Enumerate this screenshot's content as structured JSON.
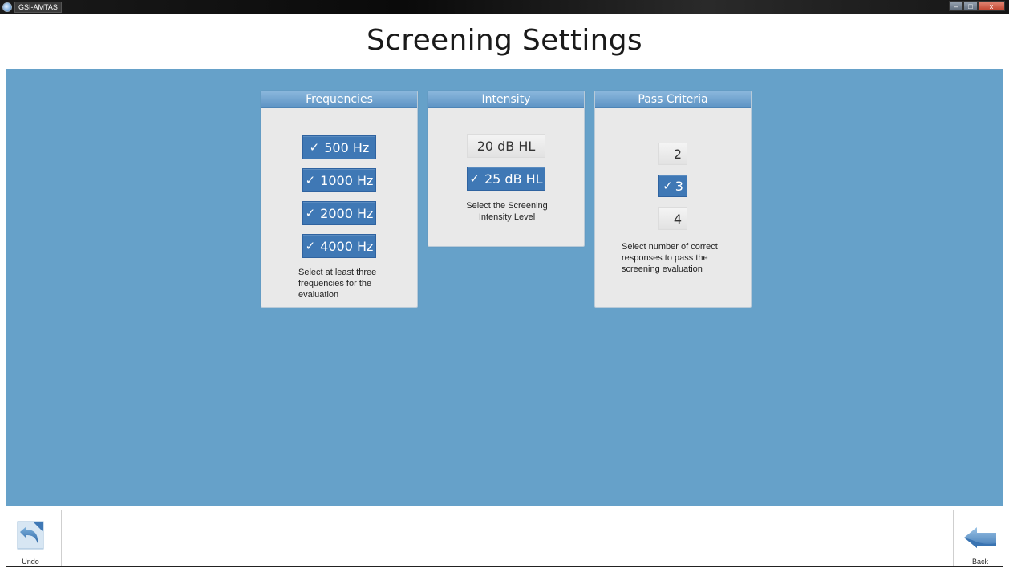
{
  "window": {
    "app_label": "GSI-AMTAS",
    "controls": {
      "minimize": "–",
      "maximize": "□",
      "close": "x"
    }
  },
  "page": {
    "title": "Screening Settings"
  },
  "frequencies": {
    "header": "Frequencies",
    "options": [
      {
        "label": "500 Hz",
        "checked": true
      },
      {
        "label": "1000 Hz",
        "checked": true
      },
      {
        "label": "2000 Hz",
        "checked": true
      },
      {
        "label": "4000 Hz",
        "checked": true
      }
    ],
    "hint_lines": [
      "Select at least three",
      "frequencies for the",
      "evaluation"
    ]
  },
  "intensity": {
    "header": "Intensity",
    "options": [
      {
        "label": "20 dB HL",
        "checked": false
      },
      {
        "label": "25 dB HL",
        "checked": true
      }
    ],
    "hint_lines": [
      "Select the Screening",
      "Intensity Level"
    ]
  },
  "pass_criteria": {
    "header": "Pass Criteria",
    "options": [
      {
        "label": "2",
        "checked": false
      },
      {
        "label": "3",
        "checked": true
      },
      {
        "label": "4",
        "checked": false
      }
    ],
    "hint_lines": [
      "Select number of correct",
      "responses to pass the",
      "screening evaluation"
    ]
  },
  "check_glyph": "✓",
  "footer": {
    "undo_label": "Undo",
    "back_label": "Back"
  },
  "colors": {
    "main_background": "#66a1c9",
    "checked_button": "#3f78b5",
    "panel_header": "#5d93c4",
    "panel_background": "#e9e9e9"
  }
}
